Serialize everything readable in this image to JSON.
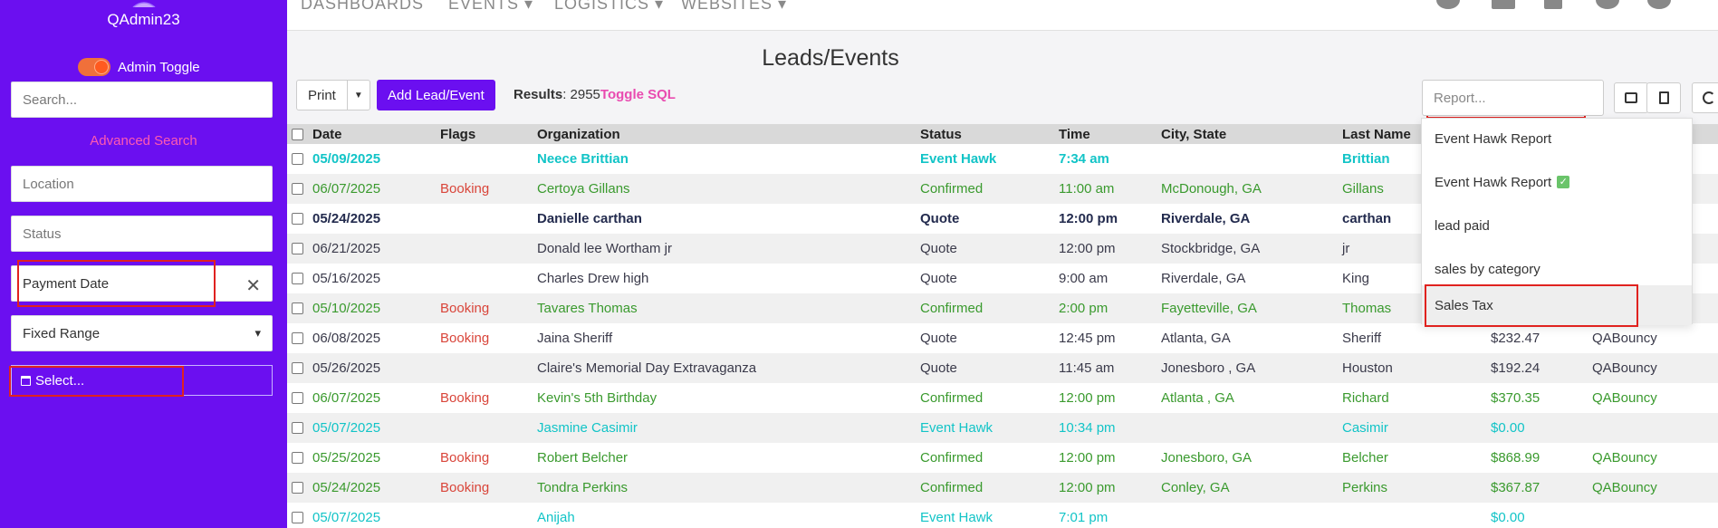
{
  "sidebar": {
    "brand": "QAdmin23",
    "admin_toggle_label": "Admin Toggle",
    "search_placeholder": "Search...",
    "advanced_search": "Advanced Search",
    "location_placeholder": "Location",
    "status_placeholder": "Status",
    "date_field_value": "Payment Date",
    "range_select_value": "Fixed Range",
    "date_picker_label": "Select...",
    "accent_color": "#6b0ff0"
  },
  "topnav": {
    "items": [
      "DASHBOARDS",
      "EVENTS",
      "LOGISTICS",
      "WEBSITES"
    ],
    "icons": [
      "moon-icon",
      "calendar-icon",
      "check-icon",
      "gear-icon",
      "info-icon"
    ]
  },
  "main": {
    "title": "Leads/Events",
    "print_label": "Print",
    "add_label": "Add Lead/Event",
    "results_label": "Results",
    "results_count": ": 2955",
    "toggle_sql": "Toggle SQL",
    "report_placeholder": "Report..."
  },
  "table": {
    "headers": [
      "Date",
      "Flags",
      "Organization",
      "Status",
      "Time",
      "City, State",
      "Last Name"
    ],
    "rows": [
      {
        "date": "05/09/2025",
        "flags": "",
        "org": "Neece Brittian",
        "status": "Event Hawk",
        "time": "7:34 am",
        "city": "",
        "last": "Brittian",
        "amount": "",
        "company": "",
        "style": "teal bold"
      },
      {
        "date": "06/07/2025",
        "flags": "Booking",
        "org": "Certoya Gillans",
        "status": "Confirmed",
        "time": "11:00 am",
        "city": "McDonough, GA",
        "last": "Gillans",
        "amount": "",
        "company": "",
        "style": "green"
      },
      {
        "date": "05/24/2025",
        "flags": "",
        "org": "Danielle carthan",
        "status": "Quote",
        "time": "12:00 pm",
        "city": "Riverdale, GA",
        "last": "carthan",
        "amount": "",
        "company": "",
        "style": "navy bold"
      },
      {
        "date": "06/21/2025",
        "flags": "",
        "org": "Donald lee Wortham jr",
        "status": "Quote",
        "time": "12:00 pm",
        "city": "Stockbridge, GA",
        "last": "jr",
        "amount": "",
        "company": "",
        "style": "dark"
      },
      {
        "date": "05/16/2025",
        "flags": "",
        "org": "Charles Drew high",
        "status": "Quote",
        "time": "9:00 am",
        "city": "Riverdale, GA",
        "last": "King",
        "amount": "",
        "company": "",
        "style": "dark"
      },
      {
        "date": "05/10/2025",
        "flags": "Booking",
        "org": "Tavares Thomas",
        "status": "Confirmed",
        "time": "2:00 pm",
        "city": "Fayetteville, GA",
        "last": "Thomas",
        "amount": "",
        "company": "",
        "style": "green"
      },
      {
        "date": "06/08/2025",
        "flags": "Booking",
        "org": "Jaina Sheriff",
        "status": "Quote",
        "time": "12:45 pm",
        "city": "Atlanta, GA",
        "last": "Sheriff",
        "amount": "$232.47",
        "company": "QABouncy",
        "style": "dark"
      },
      {
        "date": "05/26/2025",
        "flags": "",
        "org": "Claire's Memorial Day Extravaganza",
        "status": "Quote",
        "time": "11:45 am",
        "city": "Jonesboro , GA",
        "last": "Houston",
        "amount": "$192.24",
        "company": "QABouncy",
        "style": "dark"
      },
      {
        "date": "06/07/2025",
        "flags": "Booking",
        "org": "Kevin's 5th Birthday",
        "status": "Confirmed",
        "time": "12:00 pm",
        "city": "Atlanta , GA",
        "last": "Richard",
        "amount": "$370.35",
        "company": "QABouncy",
        "style": "green"
      },
      {
        "date": "05/07/2025",
        "flags": "",
        "org": "Jasmine Casimir",
        "status": "Event Hawk",
        "time": "10:34 pm",
        "city": "",
        "last": "Casimir",
        "amount": "$0.00",
        "company": "",
        "style": "teal"
      },
      {
        "date": "05/25/2025",
        "flags": "Booking",
        "org": "Robert Belcher",
        "status": "Confirmed",
        "time": "12:00 pm",
        "city": "Jonesboro, GA",
        "last": "Belcher",
        "amount": "$868.99",
        "company": "QABouncy",
        "style": "green"
      },
      {
        "date": "05/24/2025",
        "flags": "Booking",
        "org": "Tondra Perkins",
        "status": "Confirmed",
        "time": "12:00 pm",
        "city": "Conley, GA",
        "last": "Perkins",
        "amount": "$367.87",
        "company": "QABouncy",
        "style": "green"
      },
      {
        "date": "05/07/2025",
        "flags": "",
        "org": "Anijah",
        "status": "Event Hawk",
        "time": "7:01 pm",
        "city": "",
        "last": "",
        "amount": "$0.00",
        "company": "",
        "style": "teal"
      }
    ]
  },
  "report_dropdown": {
    "items": [
      "Event Hawk Report",
      "Event Hawk Report",
      "lead paid",
      "sales by category",
      "Sales Tax"
    ],
    "checked_index": 1,
    "active_index": 4
  }
}
